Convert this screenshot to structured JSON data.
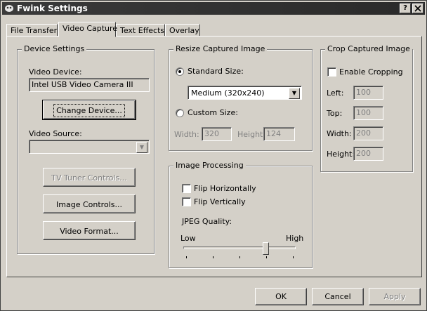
{
  "window": {
    "title": "Fwink Settings",
    "help_btn": "?",
    "close_btn": "X"
  },
  "tabs": [
    {
      "label": "File Transfer",
      "active": false
    },
    {
      "label": "Video Capture",
      "active": true
    },
    {
      "label": "Text Effects",
      "active": false
    },
    {
      "label": "Overlay",
      "active": false
    }
  ],
  "device": {
    "legend": "Device Settings",
    "video_device_label": "Video Device:",
    "video_device_value": "Intel USB Video Camera III",
    "change_device": "Change Device...",
    "video_source_label": "Video Source:",
    "video_source_value": "",
    "tv_tuner": "TV Tuner Controls...",
    "image_controls": "Image Controls...",
    "video_format": "Video Format..."
  },
  "resize": {
    "legend": "Resize Captured Image",
    "standard_size_label": "Standard Size:",
    "standard_size_selected": true,
    "standard_size_value": "Medium (320x240)",
    "custom_size_label": "Custom Size:",
    "custom_size_selected": false,
    "width_label": "Width:",
    "width_value": "320",
    "height_label": "Height:",
    "height_value": "124"
  },
  "processing": {
    "legend": "Image Processing",
    "flip_h": "Flip Horizontally",
    "flip_h_checked": false,
    "flip_v": "Flip Vertically",
    "flip_v_checked": false,
    "jpeg_label": "JPEG Quality:",
    "low_label": "Low",
    "high_label": "High",
    "jpeg_quality_level": 0.75
  },
  "crop": {
    "legend": "Crop Captured Image",
    "enable_label": "Enable Cropping",
    "enable_checked": false,
    "left_label": "Left:",
    "left_value": "100",
    "top_label": "Top:",
    "top_value": "100",
    "width_label": "Width:",
    "width_value": "200",
    "height_label": "Height:",
    "height_value": "200"
  },
  "footer": {
    "ok": "OK",
    "cancel": "Cancel",
    "apply": "Apply"
  }
}
